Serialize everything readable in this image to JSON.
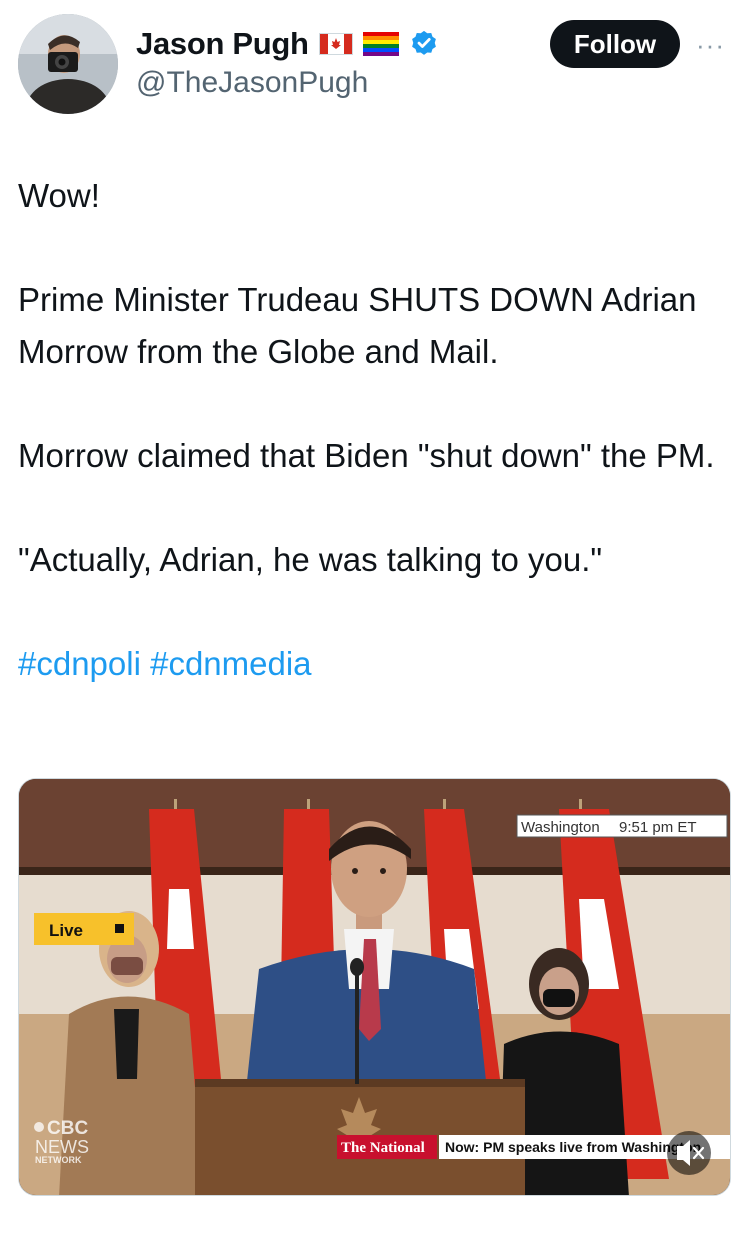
{
  "author": {
    "display_name": "Jason Pugh",
    "handle": "@TheJasonPugh",
    "avatar_icon": "photographer-avatar",
    "badges": [
      "canada-flag-icon",
      "rainbow-flag-icon",
      "verified-badge-icon"
    ]
  },
  "actions": {
    "follow_label": "Follow",
    "more_label": "···"
  },
  "tweet": {
    "paragraphs": [
      "Wow!",
      "Prime Minister Trudeau SHUTS DOWN Adrian Morrow from the Globe and Mail.",
      "Morrow claimed that Biden \"shut down\" the PM.",
      "\"Actually, Adrian, he was talking to you.\""
    ],
    "hashtags": "#cdnpoli #cdnmedia"
  },
  "video": {
    "location_tag": "Washington",
    "time_tag": "9:51 pm ET",
    "live_label": "Live",
    "network_logo_line1": "CBC",
    "network_logo_line2": "NEWS",
    "network_logo_line3": "NETWORK",
    "program_name": "The National",
    "ticker": "Now: PM speaks live from Washington",
    "mute_icon": "speaker-muted-icon"
  },
  "colors": {
    "link": "#1d9bf0",
    "text": "#0f1419",
    "secondary": "#536471",
    "follow_bg": "#0f1419",
    "verified": "#1d9bf0",
    "cbc_red": "#c8102e"
  }
}
